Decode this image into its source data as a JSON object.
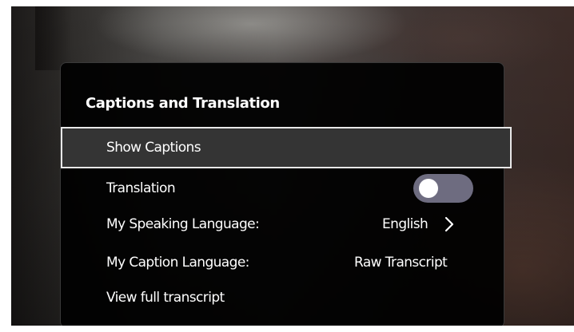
{
  "menu": {
    "title": "Captions and Translation",
    "items": [
      {
        "label": "Show Captions"
      },
      {
        "label": "Translation",
        "toggle_on": false
      },
      {
        "label": "My Speaking Language:",
        "value": "English"
      },
      {
        "label": "My Caption Language:",
        "value": "Raw Transcript"
      },
      {
        "label": "View full transcript"
      }
    ]
  },
  "colors": {
    "menu_background": "#000000",
    "highlight_background": "#343434",
    "highlight_border": "#e8e8e8",
    "toggle_track": "#6e6c80",
    "text": "#ffffff"
  },
  "icons": {
    "language_chevron": "chevron-right-icon"
  }
}
